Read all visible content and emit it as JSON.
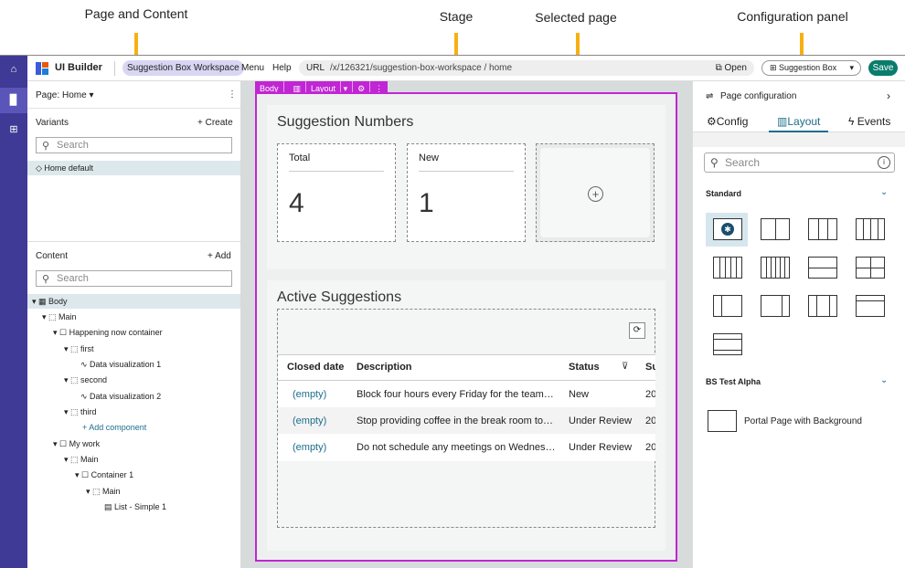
{
  "annotations": {
    "page_and_content": "Page and Content",
    "stage": "Stage",
    "selected_page": "Selected page",
    "configuration_panel": "Configuration panel"
  },
  "topbar": {
    "app_name": "UI Builder",
    "workspace": "Suggestion Box Workspace",
    "menu": "Menu",
    "help": "Help",
    "url_label": "URL",
    "url_value": "/x/126321/suggestion-box-workspace / home",
    "open": "Open",
    "app_select": "Suggestion Box",
    "save": "Save"
  },
  "left": {
    "page_label": "Page:",
    "page_value": "Home",
    "variants": "Variants",
    "create": "+ Create",
    "search_placeholder": "Search",
    "variant_item": "Home default",
    "content": "Content",
    "add": "+ Add",
    "tree": [
      "Body",
      "Main",
      "Happening now container",
      "first",
      "Data visualization 1",
      "second",
      "Data visualization 2",
      "third",
      "+ Add component",
      "My work",
      "Main",
      "Container 1",
      "Main",
      "List - Simple 1"
    ]
  },
  "stage": {
    "toolbar": {
      "body": "Body",
      "layout": "Layout"
    },
    "numbers_title": "Suggestion Numbers",
    "total_label": "Total",
    "total_value": "4",
    "new_label": "New",
    "new_value": "1",
    "active_title": "Active Suggestions",
    "columns": [
      "Closed date",
      "Description",
      "Status",
      "Su"
    ],
    "rows": [
      {
        "closed": "(empty)",
        "description": "Block four hours every Friday for the team…",
        "status": "New",
        "extra": "20"
      },
      {
        "closed": "(empty)",
        "description": "Stop providing coffee in the break room to…",
        "status": "Under Review",
        "extra": "20"
      },
      {
        "closed": "(empty)",
        "description": "Do not schedule any meetings on Wednes…",
        "status": "Under Review",
        "extra": "20"
      }
    ]
  },
  "right": {
    "title": "Page configuration",
    "tabs": [
      "Config",
      "Layout",
      "Events"
    ],
    "search_placeholder": "Search",
    "section_standard": "Standard",
    "section_alpha": "BS Test Alpha",
    "portal_item": "Portal Page with Background"
  },
  "colors": {
    "rail": "#3f3a96",
    "accent": "#c026d3",
    "save": "#0a7c6c",
    "arrow": "#f7b011"
  }
}
